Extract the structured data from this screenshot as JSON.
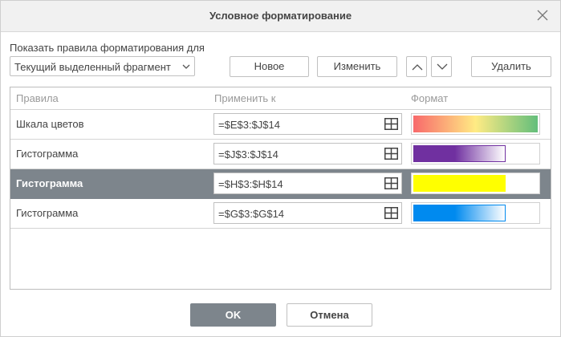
{
  "dialog": {
    "title": "Условное форматирование",
    "show_label": "Показать правила форматирования для",
    "scope_select": {
      "value": "Текущий выделенный фрагмент"
    },
    "buttons": {
      "new": "Новое",
      "edit": "Изменить",
      "delete": "Удалить",
      "ok": "OK",
      "cancel": "Отмена"
    },
    "icons": {
      "close": "close-icon",
      "up": "chevron-up-icon",
      "down": "chevron-down-icon",
      "select_caret": "chevron-down-icon",
      "range_picker": "grid-icon"
    }
  },
  "rules_table": {
    "headers": {
      "rules": "Правила",
      "apply_to": "Применить к",
      "format": "Формат"
    },
    "rows": [
      {
        "name": "Шкала цветов",
        "range": "=$E$3:$J$14",
        "format_type": "color-scale",
        "colors": [
          "#f8696b",
          "#ffeb84",
          "#63be7b"
        ],
        "selected": false
      },
      {
        "name": "Гистограмма",
        "range": "=$J$3:$J$14",
        "format_type": "data-bar",
        "colors": [
          "#7030a0",
          "#ffffff"
        ],
        "border_color": "#7030a0",
        "fill_fraction": 0.74,
        "selected": false
      },
      {
        "name": "Гистограмма",
        "range": "=$H$3:$H$14",
        "format_type": "data-bar",
        "colors": [
          "#ffff00",
          "#ffff00"
        ],
        "border_color": "#ffff00",
        "fill_fraction": 0.74,
        "selected": true
      },
      {
        "name": "Гистограмма",
        "range": "=$G$3:$G$14",
        "format_type": "data-bar",
        "colors": [
          "#008aef",
          "#ffffff"
        ],
        "border_color": "#008aef",
        "fill_fraction": 0.74,
        "selected": false
      }
    ]
  }
}
